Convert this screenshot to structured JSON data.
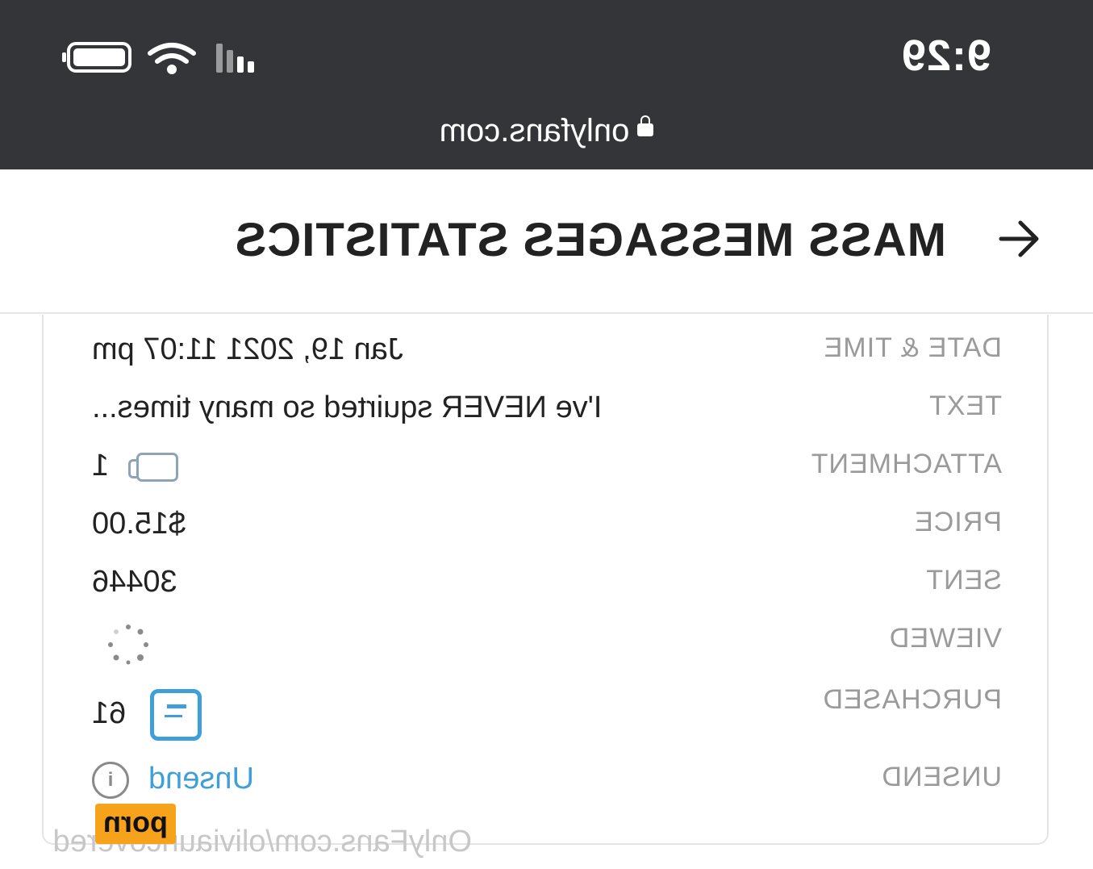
{
  "status_bar": {
    "time": "9:29"
  },
  "browser": {
    "url": "onlyfans.com"
  },
  "header": {
    "title": "MASS MESSAGES STATISTICS"
  },
  "stats": {
    "date_time": {
      "label": "DATE & TIME",
      "value": "Jan 19, 2021 11:07 pm"
    },
    "text": {
      "label": "TEXT",
      "value": "I've NEVER squirted so many times..."
    },
    "attachment": {
      "label": "ATTACHMENT",
      "value": "1",
      "icon": "video-icon"
    },
    "price": {
      "label": "PRICE",
      "value": "$15.00"
    },
    "sent": {
      "label": "SENT",
      "value": "30446"
    },
    "viewed": {
      "label": "VIEWED",
      "icon": "loading-spinner-icon"
    },
    "purchased": {
      "label": "PURCHASED",
      "value": "61",
      "icon": "message-icon"
    },
    "unsend": {
      "label": "UNSEND",
      "link": "Unsend",
      "icon": "info-icon"
    }
  },
  "watermark": {
    "text": "OnlyFans.com/oliviauncovered",
    "badge": "porn"
  },
  "colors": {
    "status_bar": "#343538",
    "link": "#3f9fd8",
    "label": "#9a9a9a",
    "badge": "#f6a21b"
  }
}
